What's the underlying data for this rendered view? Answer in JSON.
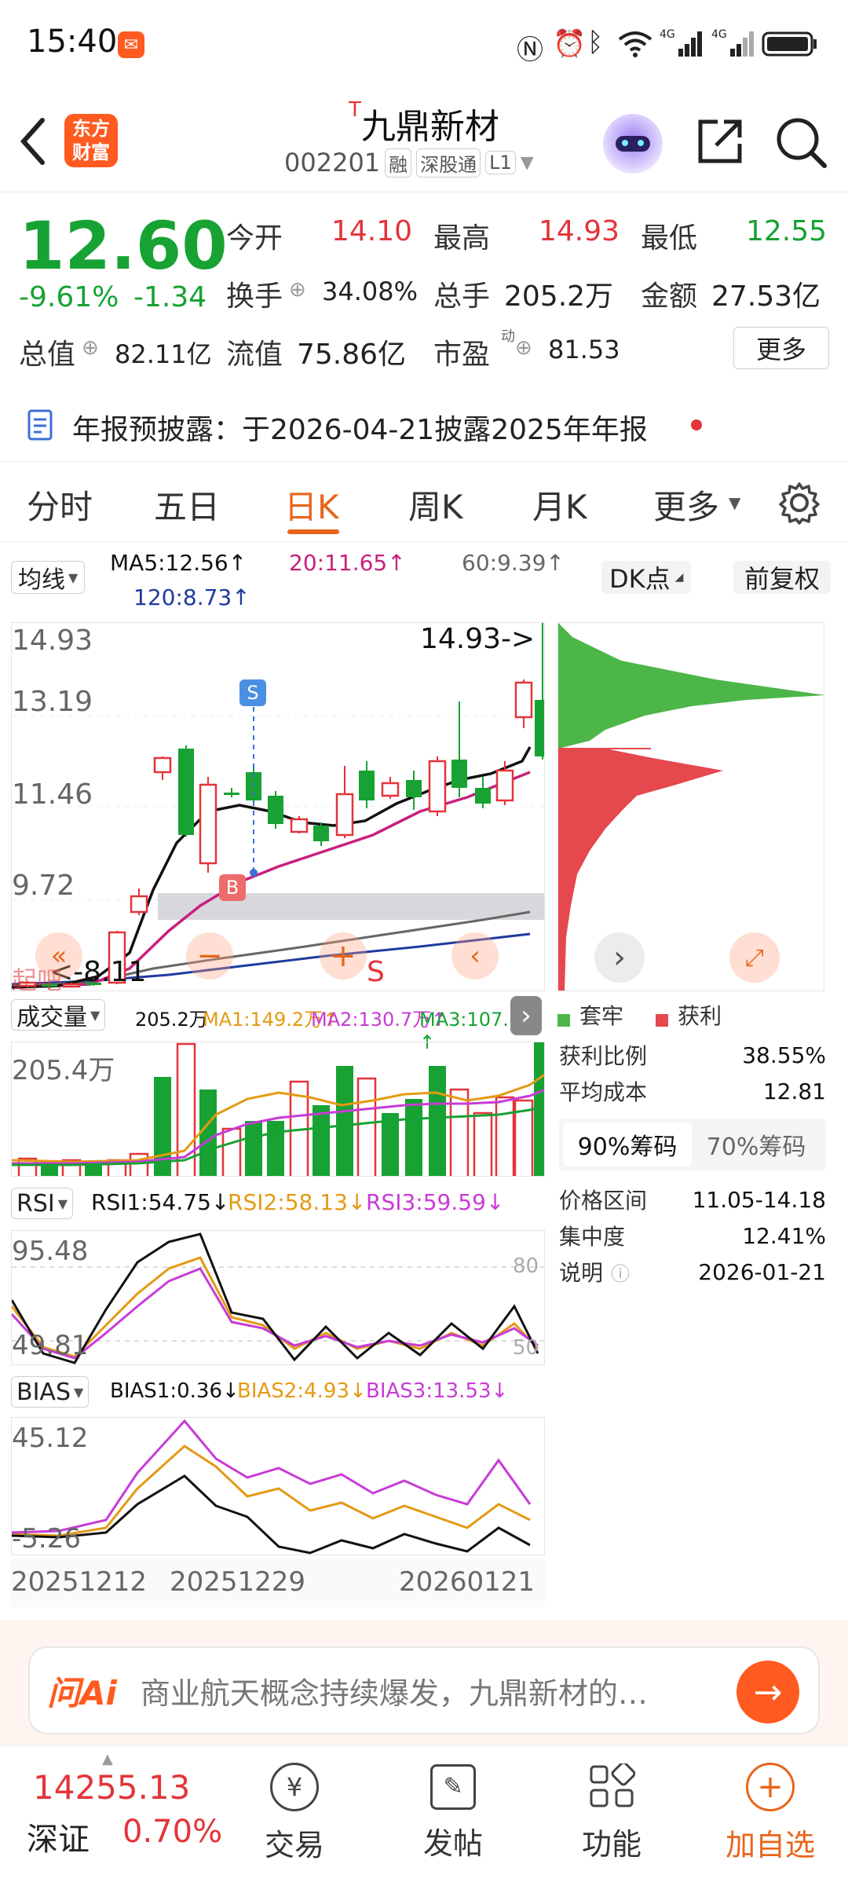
{
  "status_bar": {
    "time": "15:40",
    "icons": [
      "nfc-icon",
      "alarm-icon",
      "bluetooth-icon",
      "wifi-icon",
      "4g-signal-icon",
      "4g-signal-icon",
      "battery-icon"
    ]
  },
  "header": {
    "app_logo_line1": "东方",
    "app_logo_line2": "财富",
    "stock_prefix": "T",
    "stock_name": "九鼎新材",
    "stock_code": "002201",
    "badge_margin": "融",
    "badge_connect": "深股通",
    "badge_level": "L1"
  },
  "quote": {
    "price": "12.60",
    "change_pct": "-9.61%",
    "change_val": "-1.34",
    "open_label": "今开",
    "open": "14.10",
    "high_label": "最高",
    "high": "14.93",
    "low_label": "最低",
    "low": "12.55",
    "turnover_label": "换手",
    "turnover": "34.08%",
    "volume_label": "总手",
    "volume": "205.2万",
    "amount_label": "金额",
    "amount": "27.53亿",
    "mktcap_label": "总值",
    "mktcap": "82.11亿",
    "float_label": "流值",
    "float": "75.86亿",
    "pe_label": "市盈",
    "pe_sup": "动",
    "pe": "81.53",
    "more_label": "更多"
  },
  "notice": {
    "text": "年报预披露：于2026-04-21披露2025年年报"
  },
  "tabs": [
    "分时",
    "五日",
    "日K",
    "周K",
    "月K",
    "更多"
  ],
  "ma_row": {
    "dropdown": "均线",
    "ma5": "MA5:12.56↑",
    "ma20": "20:11.65↑",
    "ma60": "60:9.39↑",
    "ma120": "120:8.73↑",
    "dk_button": "DK点",
    "restore_button": "前复权"
  },
  "kline": {
    "y_ticks": [
      "14.93",
      "13.19",
      "11.46",
      "9.72"
    ],
    "high_marker": "14.93->",
    "low_marker": "<-8.11",
    "bottom_text": "起吧",
    "buy_marker": "B",
    "sell_marker_s": "S",
    "sell_marker_bottom": "S",
    "colors": {
      "up": "#e3343a",
      "down": "#17a233",
      "ma5": "#111111",
      "ma20": "#c8207f",
      "ma60": "#666666",
      "ma120": "#1f3a9e"
    }
  },
  "volume_panel": {
    "dropdown": "成交量",
    "total": "205.2万",
    "ma1": "MA1:149.2万↑",
    "ma2": "MA2:130.7万↑",
    "ma3": "MA3:107.1万↑",
    "y_tick": "205.4万"
  },
  "rsi_panel": {
    "dropdown": "RSI",
    "rsi1": "RSI1:54.75↓",
    "rsi2": "RSI2:58.13↓",
    "rsi3": "RSI3:59.59↓",
    "y_top": "95.48",
    "y_bottom": "49.81",
    "ref_top": "80",
    "ref_bottom": "50"
  },
  "bias_panel": {
    "dropdown": "BIAS",
    "bias1": "BIAS1:0.36↓",
    "bias2": "BIAS2:4.93↓",
    "bias3": "BIAS3:13.53↓",
    "y_top": "45.12",
    "y_bottom": "-5.26"
  },
  "x_axis_dates": [
    "20251212",
    "20251229",
    "20260121"
  ],
  "chip_panel": {
    "legend_trapped": "套牢",
    "legend_profit": "获利",
    "profit_ratio_label": "获利比例",
    "profit_ratio": "38.55%",
    "avg_cost_label": "平均成本",
    "avg_cost": "12.81",
    "tab_90": "90%筹码",
    "tab_70": "70%筹码",
    "price_range_label": "价格区间",
    "price_range": "11.05-14.18",
    "concentration_label": "集中度",
    "concentration": "12.41%",
    "note_label": "说明",
    "note_date": "2026-01-21"
  },
  "ai_bar": {
    "logo": "问Ai",
    "text": "商业航天概念持续爆发，九鼎新材的…"
  },
  "bottom_nav": {
    "index_value": "14255.13",
    "index_name": "深证",
    "index_change": "0.70%",
    "trade": "交易",
    "post": "发帖",
    "functions": "功能",
    "add_watch": "加自选"
  }
}
